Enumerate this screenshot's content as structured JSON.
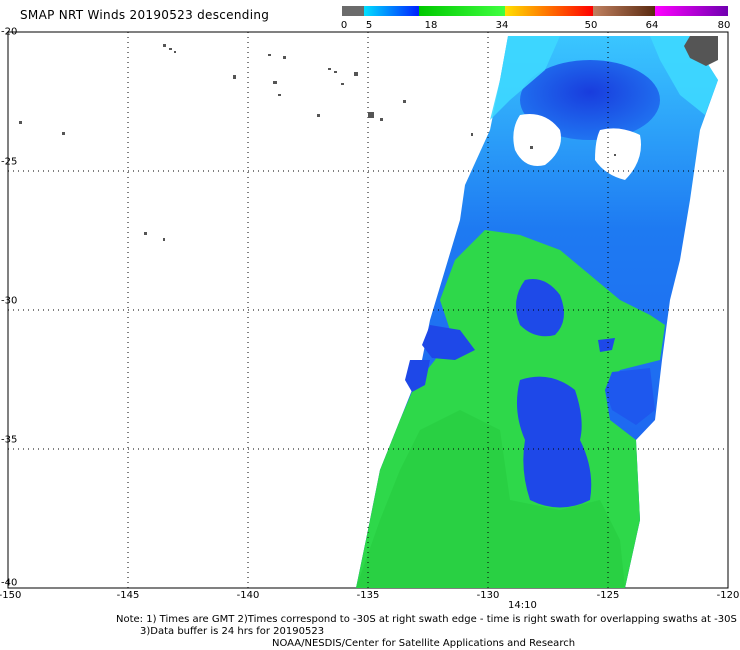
{
  "title": "SMAP NRT Winds  20190523 descending",
  "colorbar": {
    "labels": [
      "0",
      "5",
      "18",
      "34",
      "50",
      "64",
      "80"
    ],
    "colors": [
      "#6b6b6b",
      "#1e90ff",
      "#18d018",
      "#ffd700",
      "#ff7f00",
      "#e00000",
      "#a0522d",
      "#ff00ff",
      "#8a00c8"
    ]
  },
  "map": {
    "x_ticks": [
      "-150",
      "-145",
      "-140",
      "-135",
      "-130",
      "-125",
      "-120"
    ],
    "y_ticks": [
      "-20",
      "-25",
      "-30",
      "-35",
      "-40"
    ],
    "land_color": "#555555",
    "swath_colors": {
      "blue_dark": "#1c3ee0",
      "blue_mid": "#1e6cf0",
      "blue_light": "#36c8ff",
      "green": "#2ed84a",
      "green_light": "#4cf060"
    }
  },
  "time_label": "14:10",
  "notes": {
    "line1": "Note: 1) Times are GMT 2)Times correspond to -30S at right swath edge - time is right swath for overlapping swaths at -30S",
    "line2": "3)Data buffer is 24 hrs for 20190523",
    "line3": "NOAA/NESDIS/Center for Satellite Applications and Research"
  }
}
